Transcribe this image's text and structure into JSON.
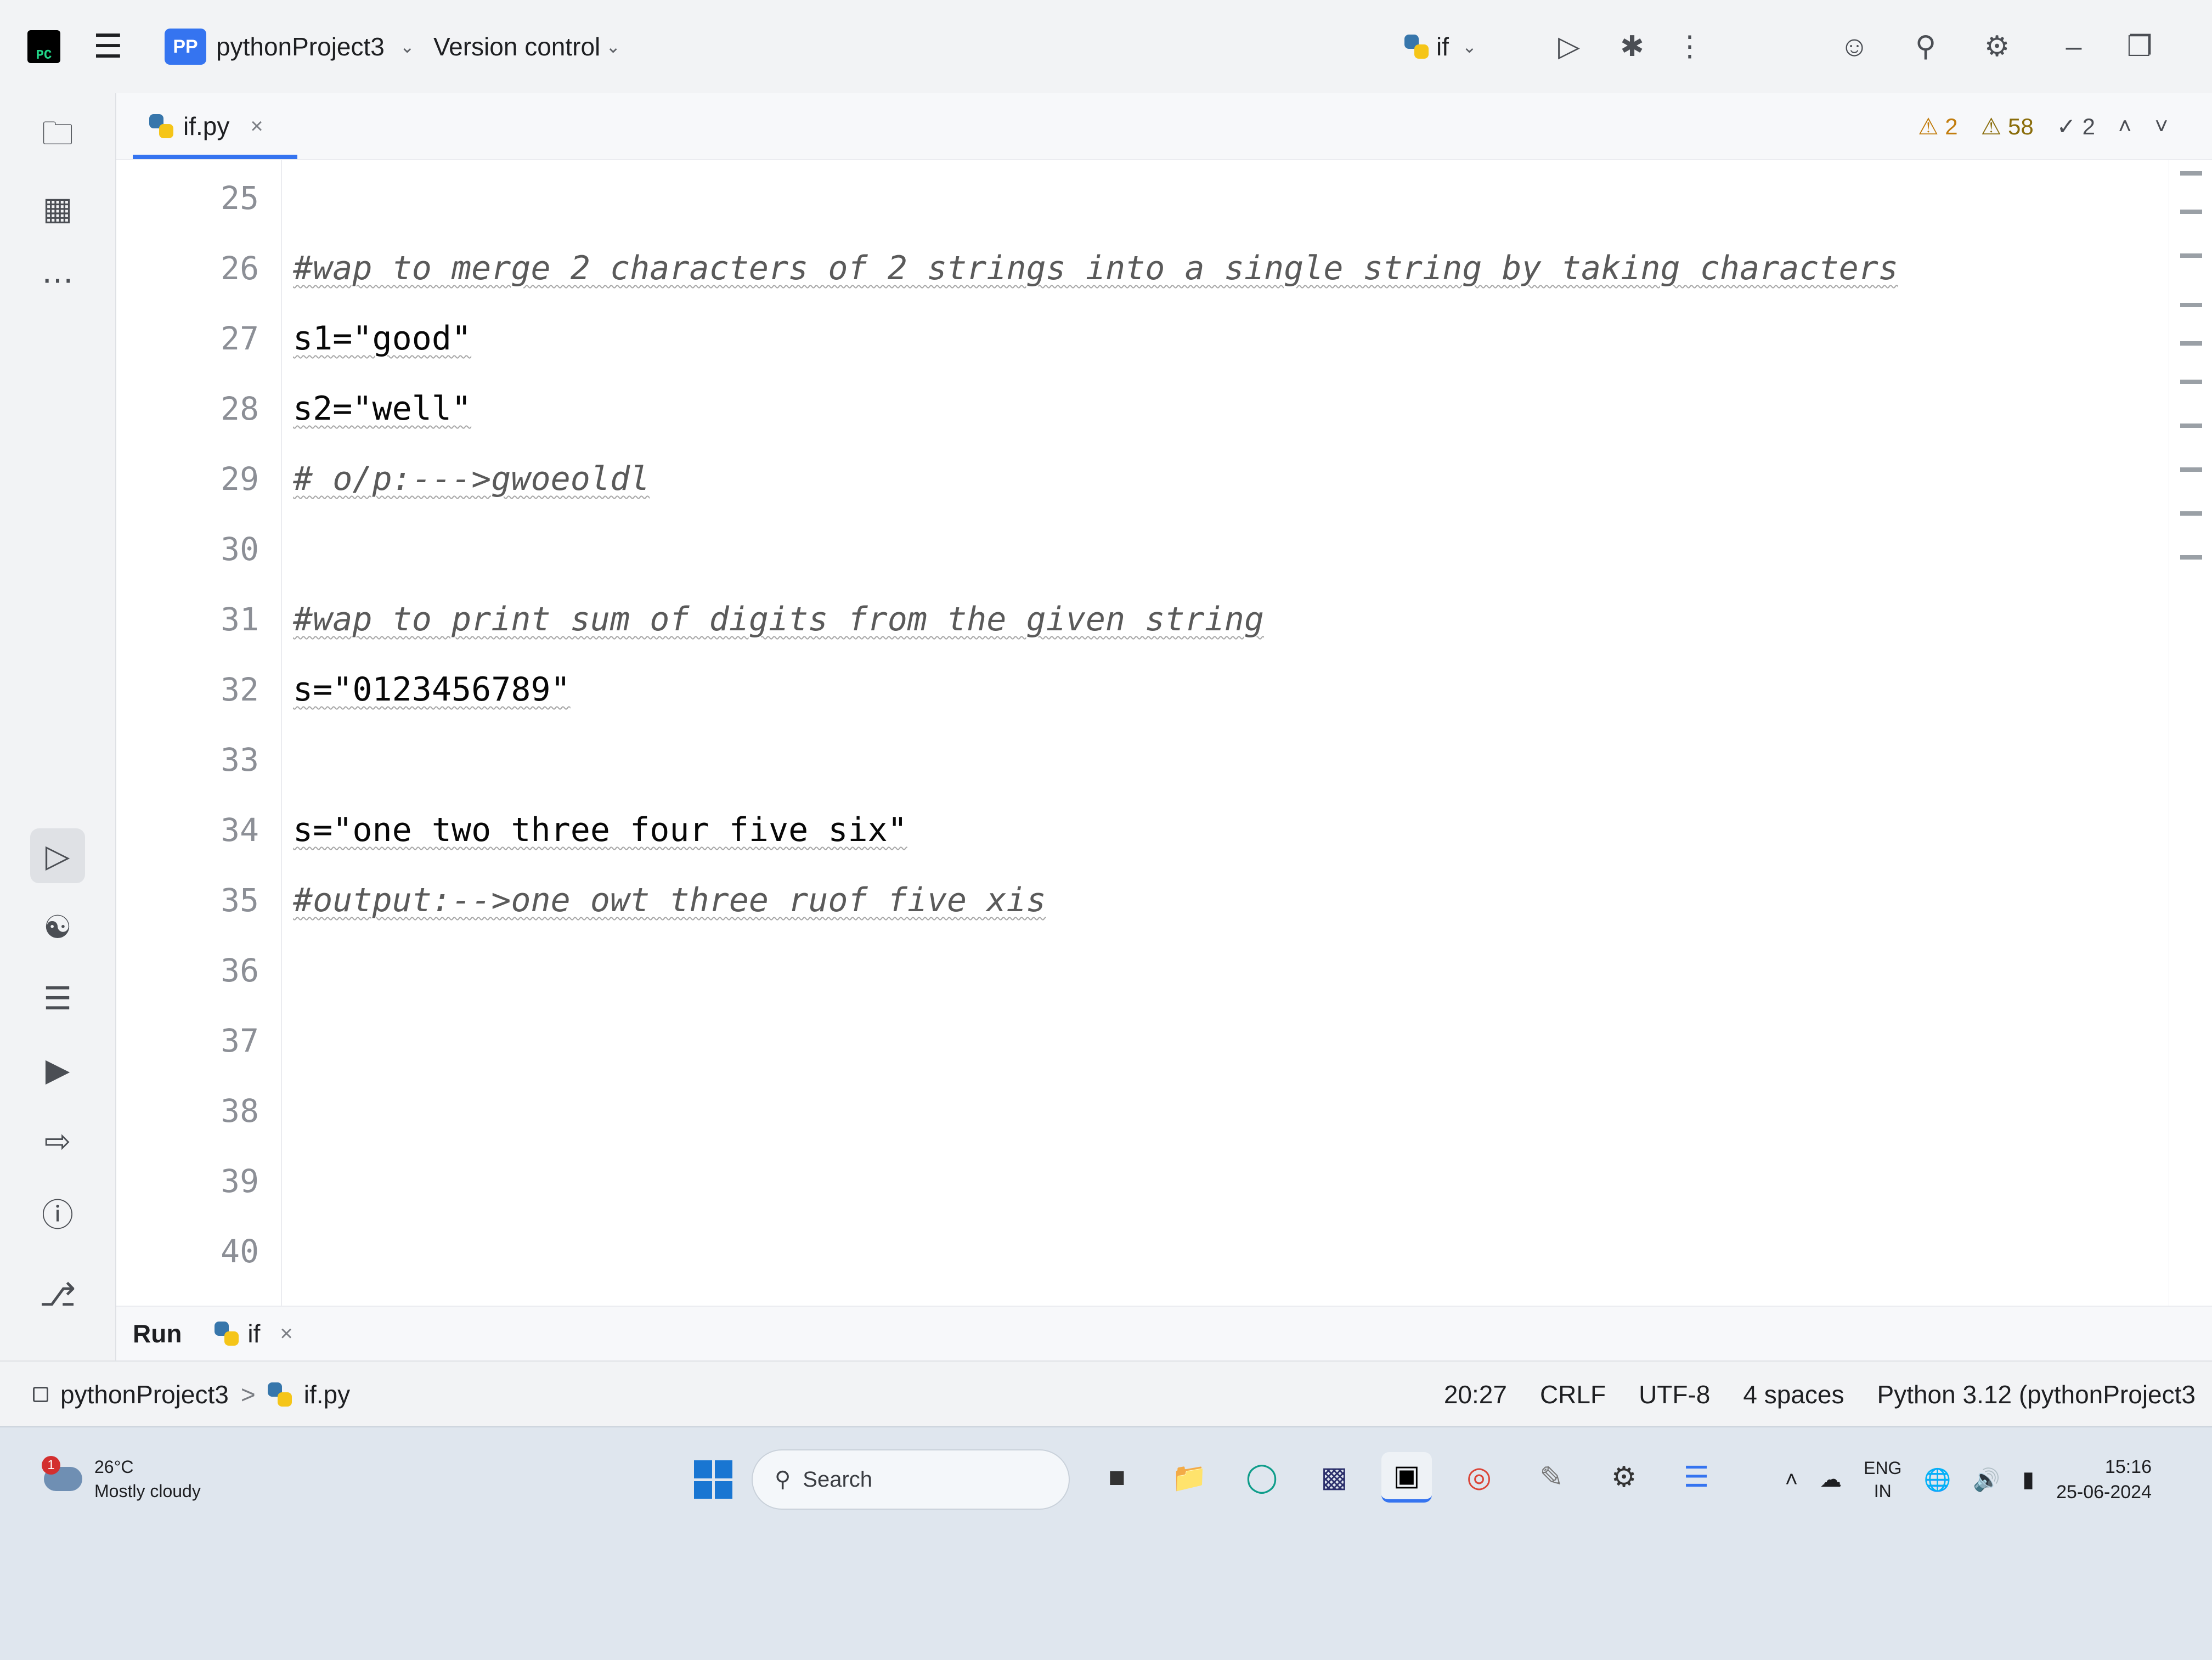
{
  "titlebar": {
    "project_badge": "PP",
    "project_name": "pythonProject3",
    "version_control": "Version control",
    "run_config": "if"
  },
  "tab": {
    "filename": "if.py",
    "close": "×"
  },
  "inspections": {
    "errors": "2",
    "warnings": "58",
    "weak_warnings": "2"
  },
  "editor": {
    "lines": [
      {
        "num": "25",
        "text": ""
      },
      {
        "num": "26",
        "text": "#wap to merge 2 characters of 2 strings into a single string by taking characters"
      },
      {
        "num": "27",
        "text": "s1=\"good\""
      },
      {
        "num": "28",
        "text": "s2=\"well\""
      },
      {
        "num": "29",
        "text": "# o/p:--->gwoeoldl"
      },
      {
        "num": "30",
        "text": ""
      },
      {
        "num": "31",
        "text": "#wap to print sum of digits from the given string"
      },
      {
        "num": "32",
        "text": "s=\"0123456789\""
      },
      {
        "num": "33",
        "text": ""
      },
      {
        "num": "34",
        "text": "s=\"one two three four five six\""
      },
      {
        "num": "35",
        "text": "#output:-->one owt three ruof five xis"
      },
      {
        "num": "36",
        "text": ""
      },
      {
        "num": "37",
        "text": ""
      },
      {
        "num": "38",
        "text": ""
      },
      {
        "num": "39",
        "text": ""
      },
      {
        "num": "40",
        "text": ""
      }
    ]
  },
  "runbar": {
    "label": "Run",
    "tab": "if",
    "close": "×"
  },
  "statusbar": {
    "breadcrumb_project": "pythonProject3",
    "breadcrumb_sep": ">",
    "breadcrumb_file": "if.py",
    "position": "20:27",
    "line_sep": "CRLF",
    "encoding": "UTF-8",
    "indent": "4 spaces",
    "interpreter": "Python 3.12 (pythonProject3"
  },
  "taskbar": {
    "weather_badge": "1",
    "temperature": "26°C",
    "weather": "Mostly cloudy",
    "search_placeholder": "Search",
    "lang_top": "ENG",
    "lang_bottom": "IN",
    "time": "15:16",
    "date": "25-06-2024"
  },
  "colors": {
    "accent": "#3574f0",
    "string": "#067d17",
    "comment": "#5a5a5a"
  }
}
